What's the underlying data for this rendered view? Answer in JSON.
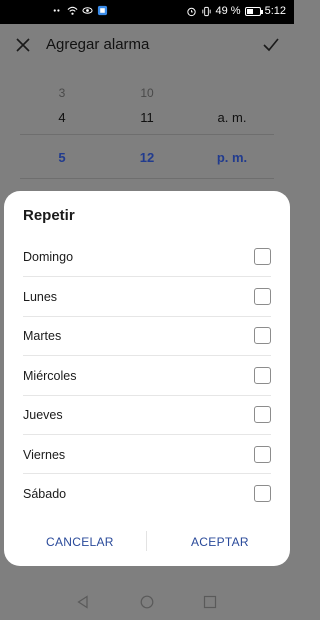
{
  "status_bar": {
    "battery": "49 %",
    "time": "5:12",
    "battery_level": 0.49
  },
  "header": {
    "title": "Agregar alarma"
  },
  "picker": {
    "hours": [
      "3",
      "4",
      "5"
    ],
    "minutes": [
      "10",
      "11",
      "12"
    ],
    "periods": [
      "a. m.",
      "p. m."
    ]
  },
  "dialog": {
    "title": "Repetir",
    "days": [
      {
        "label": "Domingo",
        "checked": false
      },
      {
        "label": "Lunes",
        "checked": false
      },
      {
        "label": "Martes",
        "checked": false
      },
      {
        "label": "Miércoles",
        "checked": false
      },
      {
        "label": "Jueves",
        "checked": false
      },
      {
        "label": "Viernes",
        "checked": false
      },
      {
        "label": "Sábado",
        "checked": false
      }
    ],
    "cancel_label": "CANCELAR",
    "accept_label": "ACEPTAR"
  },
  "colors": {
    "accent": "#213b8e",
    "scrim": "#7f7f7f"
  }
}
